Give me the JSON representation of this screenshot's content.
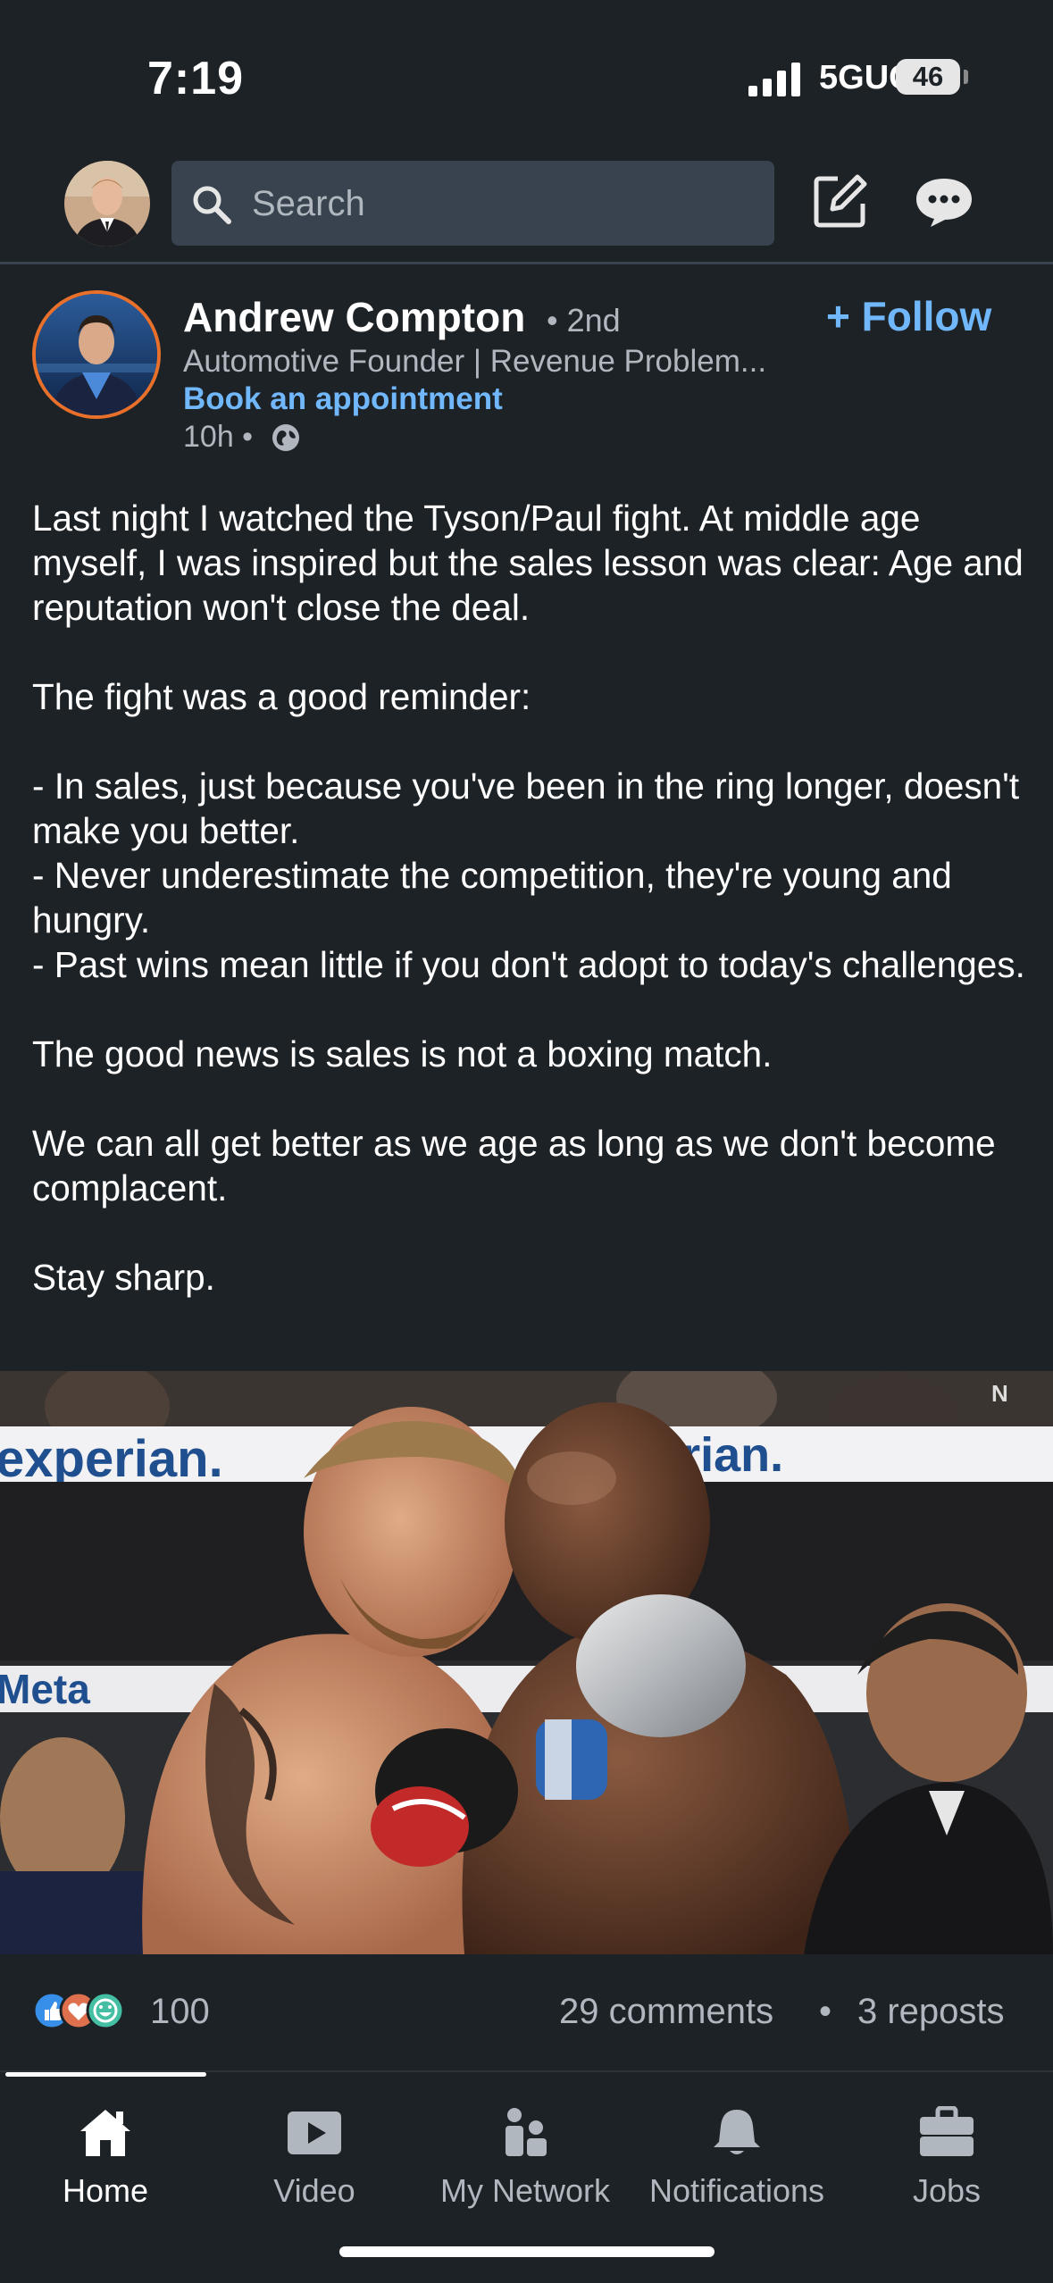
{
  "status_bar": {
    "time": "7:19",
    "network": "5GUC",
    "battery": "46"
  },
  "top_bar": {
    "search_placeholder": "Search"
  },
  "post": {
    "author": {
      "name": "Andrew Compton",
      "degree": "• 2nd",
      "headline": "Automotive Founder | Revenue Problem...",
      "appointment_link": "Book an appointment",
      "time": "10h •",
      "follow_label": "+ Follow"
    },
    "body": {
      "p1": "Last night I watched the Tyson/Paul fight.  At middle age myself, I was inspired but the sales lesson was clear: Age and reputation won't close the deal.",
      "p2": "The fight was a good reminder:",
      "bullet1": "- In sales, just because you've been in the ring longer, doesn't make you better.",
      "bullet2": "- Never underestimate the competition, they're young and hungry.",
      "bullet3": "- Past wins mean little if you don't adopt to today's challenges.",
      "p3": "The good news is sales is not a boxing match.",
      "p4": "We can all get better as we age as long as we don't become complacent.",
      "p5": "Stay sharp."
    },
    "image": {
      "ring_text_1": "experian.",
      "ring_text_2": "experian.",
      "ring_text_3": "Meta",
      "corner_mark": "N"
    },
    "social": {
      "reactions_count": "100",
      "comments": "29 comments",
      "separator": "•",
      "reposts": "3 reposts"
    }
  },
  "bottom_nav": {
    "items": [
      {
        "label": "Home",
        "icon": "home-icon"
      },
      {
        "label": "Video",
        "icon": "video-icon"
      },
      {
        "label": "My Network",
        "icon": "network-icon"
      },
      {
        "label": "Notifications",
        "icon": "bell-icon"
      },
      {
        "label": "Jobs",
        "icon": "briefcase-icon"
      }
    ],
    "active": "Home"
  },
  "colors": {
    "background": "#1d2226",
    "accent_link": "#71b7fb",
    "search_bg": "#38434f",
    "avatar_ring": "#e8702a"
  }
}
